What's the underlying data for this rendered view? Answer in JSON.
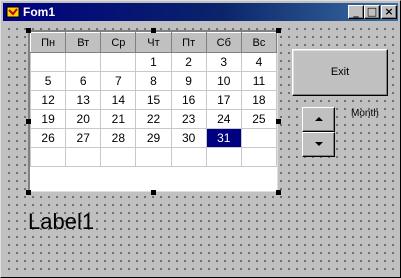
{
  "window": {
    "title": "Fom1",
    "controls": {
      "minimize": "_",
      "maximize": "□",
      "close": "×"
    }
  },
  "calendar": {
    "headers": [
      "Пн",
      "Вт",
      "Ср",
      "Чт",
      "Пт",
      "Сб",
      "Вс"
    ],
    "rows": [
      [
        "",
        "",
        "",
        "1",
        "2",
        "3",
        "4"
      ],
      [
        "5",
        "6",
        "7",
        "8",
        "9",
        "10",
        "11"
      ],
      [
        "12",
        "13",
        "14",
        "15",
        "16",
        "17",
        "18"
      ],
      [
        "19",
        "20",
        "21",
        "22",
        "23",
        "24",
        "25"
      ],
      [
        "26",
        "27",
        "28",
        "29",
        "30",
        "31",
        ""
      ],
      [
        "",
        "",
        "",
        "",
        "",
        "",
        ""
      ]
    ],
    "selected_day": "31",
    "selected_color": "#000080"
  },
  "exit_button": {
    "label": "Exit"
  },
  "updown": {
    "up_icon": "arrow-up-icon",
    "down_icon": "arrow-down-icon"
  },
  "month_label": {
    "text": "Month"
  },
  "label1": {
    "text": "Label1"
  }
}
